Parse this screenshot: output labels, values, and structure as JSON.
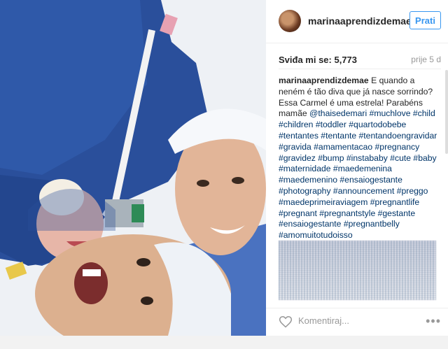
{
  "post": {
    "username": "marinaaprendizdemae",
    "follow_label": "Prati",
    "likes": "Sviđa mi se: 5,773",
    "time": "prije 5 d",
    "caption_username": "marinaaprendizdemae",
    "caption_text": "E quando a neném é tão diva que já nasce sorrindo? Essa Carmel é uma estrela! Parabéns mamãe",
    "caption_tags": "@thaisedemari #muchlove #child #children #toddler #quartodobebe #tentantes #tentante #tentandoengravidar #gravida #amamentacao #pregnancy #gravidez #bump #instababy #cute #baby #maternidade #maedemenina #maedemenino #ensaiogestante #photography #announcement #preggo #maedeprimeiraviagem #pregnantlife #pregnant #pregnantstyle #gestante #ensaiogestante #pregnantbelly #amomuitotudoisso",
    "comment_placeholder": "Komentiraj...",
    "more_label": "•••"
  },
  "icons": {
    "like": "heart-icon",
    "more": "more-options-icon"
  },
  "colors": {
    "follow_blue": "#3897f0",
    "hashtag": "#003569",
    "muted": "#999999"
  }
}
